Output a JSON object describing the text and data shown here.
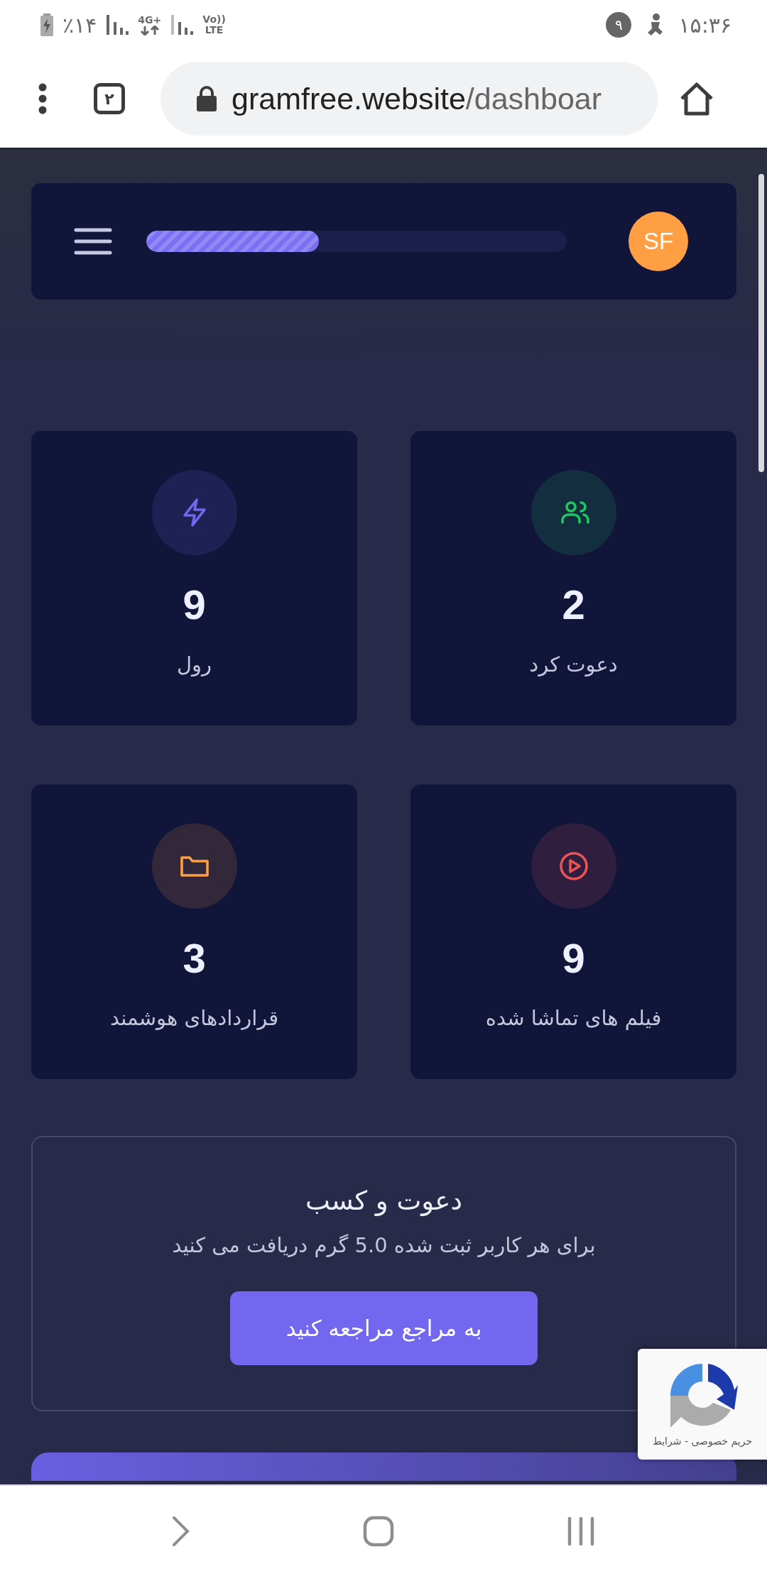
{
  "status_bar": {
    "battery": "٪۱۴",
    "network": "4G+",
    "volte_top": "Vo))",
    "volte_bottom": "LTE",
    "notification_count": "۹",
    "time": "۱۵:۳۶"
  },
  "browser": {
    "tab_count": "۲",
    "url_host": "gramfree.website",
    "url_path": "/dashboar"
  },
  "header": {
    "progress": {
      "level": 0.41
    },
    "avatar": "SF"
  },
  "stats": [
    {
      "kind": "users",
      "color": "#22c55e",
      "value": "2",
      "label": "دعوت کرد"
    },
    {
      "kind": "bolt",
      "color": "#7367f0",
      "value": "9",
      "label": "رول"
    },
    {
      "kind": "play",
      "color": "#ea5455",
      "value": "9",
      "label": "فیلم های تماشا شده"
    },
    {
      "kind": "folder",
      "color": "#ff9f43",
      "value": "3",
      "label": "قراردادهای هوشمند"
    }
  ],
  "invite": {
    "title": "دعوت و کسب",
    "text": "برای هر کاربر ثبت شده 5.0 گرم دریافت می کنید",
    "button": "به مراجع مراجعه کنید"
  },
  "recaptcha": {
    "links": "حریم خصوصی - شرایط"
  }
}
